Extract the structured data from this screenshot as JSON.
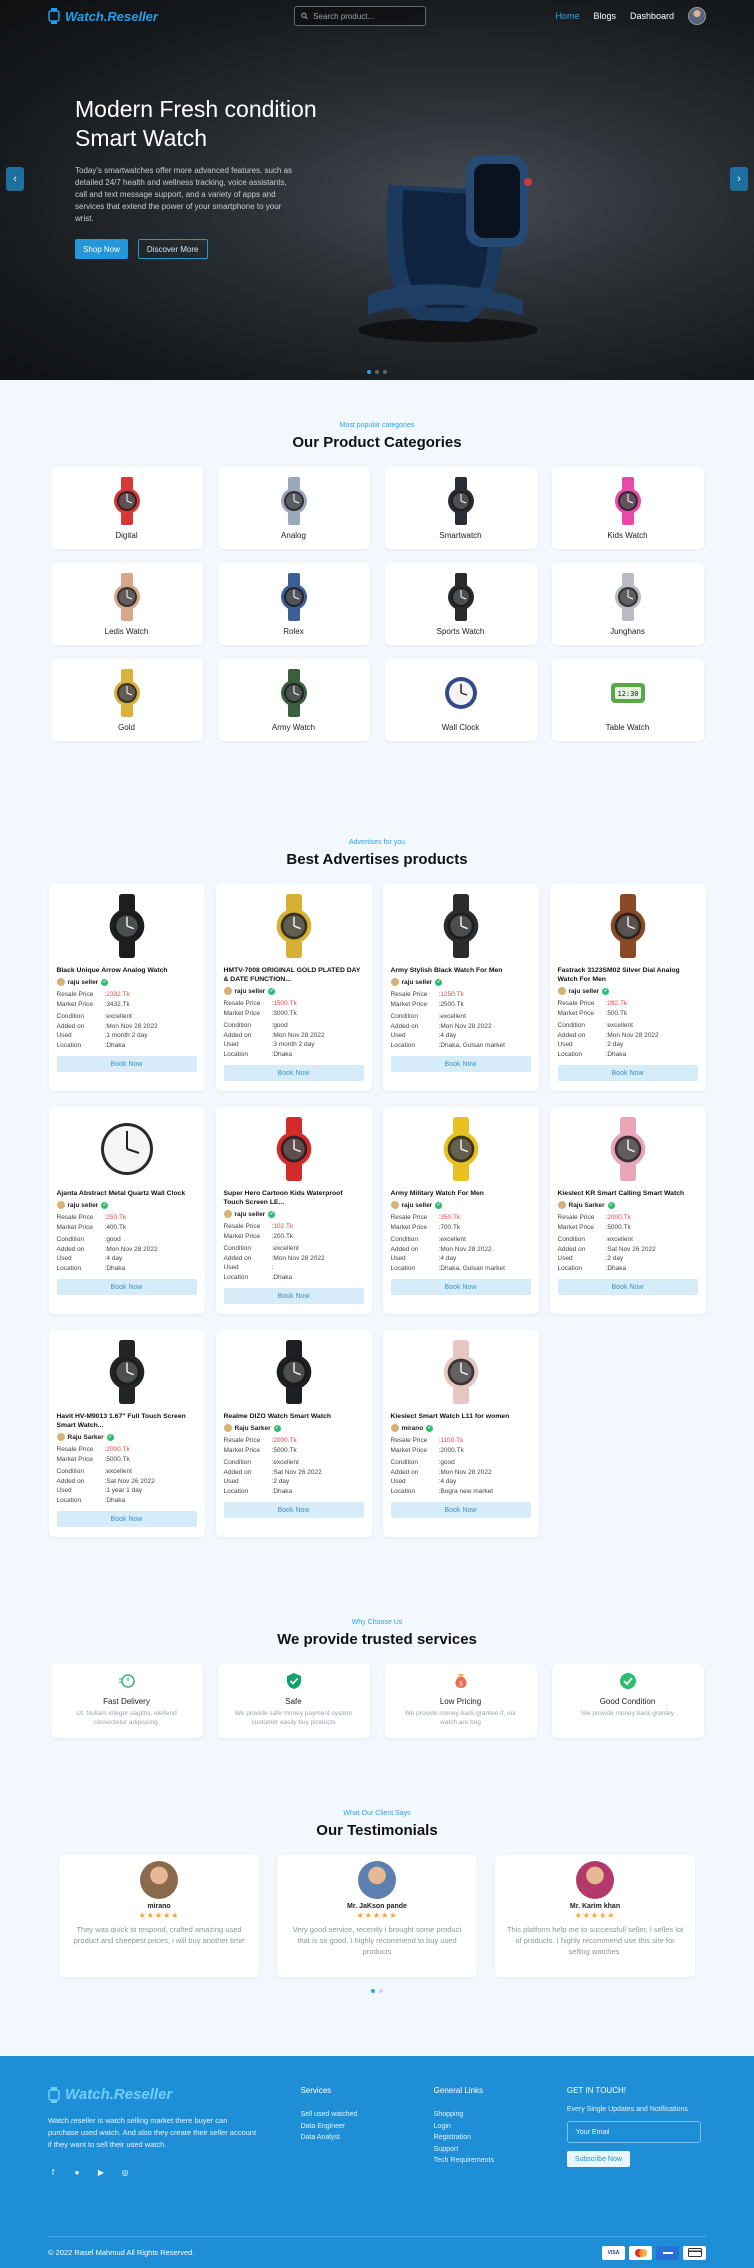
{
  "nav": {
    "logo": "Watch.Reseller",
    "search_placeholder": "Search product...",
    "links": [
      "Home",
      "Blogs",
      "Dashboard"
    ]
  },
  "hero": {
    "title": "Modern Fresh condition\nSmart Watch",
    "description": "Today's smartwatches offer more advanced features, such as detailed 24/7 health and wellness tracking, voice assistants, call and text message support, and a variety of apps and services that extend the power of your smartphone to your wrist.",
    "primary_button": "Shop Now",
    "secondary_button": "Discover More",
    "prev_icon": "chevron-left-icon",
    "next_icon": "chevron-right-icon",
    "slides": 3,
    "active_slide": 1
  },
  "categories": {
    "subtitle": "Most popular categories",
    "title": "Our Product Categories",
    "items": [
      {
        "name": "Digital",
        "icon": "digital-watch-icon",
        "color": "#d63838"
      },
      {
        "name": "Analog",
        "icon": "analog-watch-icon",
        "color": "#9aa8b8"
      },
      {
        "name": "Smartwatch",
        "icon": "smartwatch-icon",
        "color": "#2a2e36"
      },
      {
        "name": "Kids Watch",
        "icon": "kids-watch-icon",
        "color": "#e84aa8"
      },
      {
        "name": "Ledis Watch",
        "icon": "ladies-watch-icon",
        "color": "#d8a68c"
      },
      {
        "name": "Rolex",
        "icon": "rolex-watch-icon",
        "color": "#3d5f95"
      },
      {
        "name": "Sports Watch",
        "icon": "sports-watch-icon",
        "color": "#2a2a2a"
      },
      {
        "name": "Junghans",
        "icon": "junghans-watch-icon",
        "color": "#b8bcc2"
      },
      {
        "name": "Gold",
        "icon": "gold-watch-icon",
        "color": "#d9b13c"
      },
      {
        "name": "Army Watch",
        "icon": "army-watch-icon",
        "color": "#3b5e3f"
      },
      {
        "name": "Wall Clock",
        "icon": "wall-clock-icon",
        "color": "#324a8c"
      },
      {
        "name": "Table Watch",
        "icon": "table-clock-icon",
        "color": "#5aa848"
      }
    ]
  },
  "advertises": {
    "subtitle": "Advertises for you",
    "title": "Best Advertises products",
    "labels": {
      "resale": "Resale Price",
      "market": "Market Price",
      "condition": "Condition",
      "added": "Added on",
      "used": "Used",
      "location": "Location",
      "book": "Book Now"
    },
    "products": [
      {
        "title": "Black Unique Arrow Analog Watch",
        "seller": "raju seller",
        "resale": "2332.Tk",
        "market": "3432.Tk",
        "condition": "excellent",
        "added": "Mon Nov 28 2022",
        "used": "1 month 2 day",
        "location": "Dhaka",
        "color": "#1e1e20"
      },
      {
        "title": "HMTV-7008 ORIGINAL GOLD PLATED DAY & DATE FUNCTION...",
        "seller": "raju seller",
        "resale": "1500.Tk",
        "market": "3000.Tk",
        "condition": "good",
        "added": "Mon Nov 28 2022",
        "used": "3 month 2 day",
        "location": "Dhaka",
        "color": "#d7b033"
      },
      {
        "title": "Army Stylish Black Watch For Men",
        "seller": "raju seller",
        "resale": "1250.Tk",
        "market": "2500.Tk",
        "condition": "excellent",
        "added": "Mon Nov 28 2022",
        "used": "4 day",
        "location": "Dhaka, Gulsan market",
        "color": "#2a2c2e"
      },
      {
        "title": "Fastrack 3123SM02 Silver Dial Analog Watch For Men",
        "seller": "raju seller",
        "resale": "292.Tk",
        "market": "500.Tk",
        "condition": "excellent",
        "added": "Mon Nov 28 2022",
        "used": "2 day",
        "location": "Dhaka",
        "color": "#8b4a26"
      },
      {
        "title": "Ajanta Abstract Metal Quartz Wall Clock",
        "seller": "raju seller",
        "resale": "250.Tk",
        "market": "400.Tk",
        "condition": "good",
        "added": "Mon Nov 28 2022",
        "used": "4 day",
        "location": "Dhaka",
        "color": "#cfd3d6"
      },
      {
        "title": "Super Hero Cartoon Kids Waterproof Touch Screen LE...",
        "seller": "raju seller",
        "resale": "102.Tk",
        "market": "200.Tk",
        "condition": "excellent",
        "added": "Mon Nov 28 2022",
        "used": "",
        "location": "Dhaka",
        "color": "#d52a2a"
      },
      {
        "title": "Army Military Watch For Men",
        "seller": "raju seller",
        "resale": "350.Tk",
        "market": "700.Tk",
        "condition": "excellent",
        "added": "Mon Nov 28 2022",
        "used": "4 day",
        "location": "Dhaka, Gulsan market",
        "color": "#e8c020"
      },
      {
        "title": "Kieslect KR Smart Calling Smart Watch",
        "seller": "Raju Sarker",
        "resale": "2000.Tk",
        "market": "5000.Tk",
        "condition": "excellent",
        "added": "Sat Nov 26 2022",
        "used": "2 day",
        "location": "Dhaka",
        "color": "#e9a5b8"
      },
      {
        "title": "Havit HV-M9013 1.67\" Full Touch Screen Smart Watch...",
        "seller": "Raju Sarker",
        "resale": "2000.Tk",
        "market": "5000.Tk",
        "condition": "excellent",
        "added": "Sat Nov 26 2022",
        "used": "1 year 1 day",
        "location": "Dhaka",
        "color": "#222428"
      },
      {
        "title": "Realme DIZO Watch Smart Watch",
        "seller": "Raju Sarker",
        "resale": "2000.Tk",
        "market": "5000.Tk",
        "condition": "excellent",
        "added": "Sat Nov 26 2022",
        "used": "2 day",
        "location": "Dhaka",
        "color": "#1d1f22"
      },
      {
        "title": "Kieslect Smart Watch L11 for women",
        "seller": "mirano",
        "resale": "1100.Tk",
        "market": "2000.Tk",
        "condition": "good",
        "added": "Mon Nov 28 2022",
        "used": "4 day",
        "location": "Bogra new market",
        "color": "#e7c6c3"
      }
    ]
  },
  "services": {
    "subtitle": "Why Choose Us",
    "title": "We provide trusted services",
    "items": [
      {
        "title": "Fast Delivery",
        "desc": "Ut. Nullam integer sagittis, eleifend consectetur adipiscing.",
        "icon": "fast-delivery-icon",
        "color": "#2dbd6e"
      },
      {
        "title": "Safe",
        "desc": "We provide safe money payment system customer easily buy products",
        "icon": "shield-check-icon",
        "color": "#18a06a"
      },
      {
        "title": "Low Pricing",
        "desc": "We provide money back grantee if, our watch are bug",
        "icon": "money-bag-icon",
        "color": "#e86f4e"
      },
      {
        "title": "Good Condition",
        "desc": "We provide money back grantey",
        "icon": "check-circle-icon",
        "color": "#2dbd6e"
      }
    ]
  },
  "testimonials": {
    "subtitle": "What Our Client Says",
    "title": "Our Testimonials",
    "items": [
      {
        "name": "mirano",
        "stars": "★★★★★",
        "text": "They was quick to respond, crafted amazing used product and cheepest prices, i will buy another time",
        "avatar_color": "#8a6a4d"
      },
      {
        "name": "Mr. JaKson pande",
        "stars": "★★★★★",
        "text": "Very good service, recently i brought some product that is so good. I highly recommend to buy used products",
        "avatar_color": "#5c7fb0"
      },
      {
        "name": "Mr. Karim khan",
        "stars": "★★★★★",
        "text": "This platform help me to successfull seller, I selles lot of products. I highly recommend use this site for selling watches.",
        "avatar_color": "#b23a6a"
      }
    ]
  },
  "footer": {
    "logo": "Watch.Reseller",
    "description": "Watch.reseller is watch selling market there buyer can purchase used watch. And also they create their seller account if they want to sell their used watch.",
    "socials": [
      "facebook-icon",
      "github-icon",
      "youtube-icon",
      "instagram-icon"
    ],
    "services_title": "Services",
    "services": [
      "Sell used watched",
      "Data Engineer",
      "Data Analyst"
    ],
    "links_title": "General Links",
    "links": [
      "Shopping",
      "Login",
      "Registration",
      "Support",
      "Tech Requirements"
    ],
    "touch_title": "GET IN TOUCH!",
    "touch_text": "Every Single Updates and Notifications",
    "email_placeholder": "Your Email",
    "subscribe": "Subscribe Now",
    "copyright": "© 2022 Rasel Mahmud All Rights Reserved.",
    "payments": [
      "VISA",
      "MC",
      "AMEX",
      "Card"
    ]
  }
}
